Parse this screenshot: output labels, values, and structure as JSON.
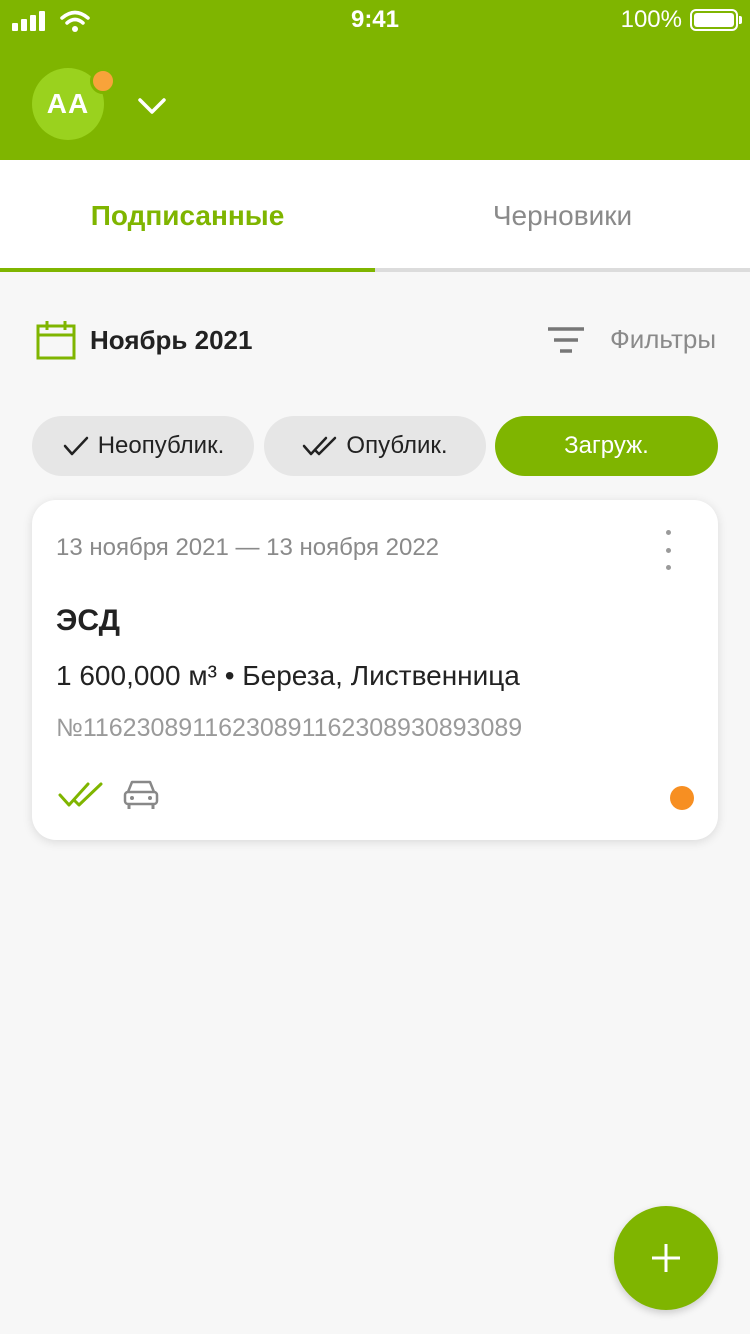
{
  "statusbar": {
    "time": "9:41",
    "battery": "100%"
  },
  "account": {
    "initials": "AA"
  },
  "tabs": [
    {
      "label": "Подписанные",
      "active": true
    },
    {
      "label": "Черновики",
      "active": false
    }
  ],
  "period": {
    "label": "Ноябрь 2021"
  },
  "filters": {
    "label": "Фильтры"
  },
  "chips": [
    {
      "label": "Неопублик.",
      "icon": "check-icon",
      "active": false
    },
    {
      "label": "Опублик.",
      "icon": "double-check-icon",
      "active": false
    },
    {
      "label": "Загруж.",
      "icon": "",
      "active": true
    }
  ],
  "cards": [
    {
      "date_range": "13 ноября 2021 — 13 ноября 2022",
      "title": "ЭСД",
      "volume": "1 600,000 м³ • Береза, Лиственница",
      "number": "№11623089116230891162308930893089",
      "icons": [
        "double-check-icon",
        "car-icon"
      ]
    }
  ],
  "colors": {
    "brand": "#7fb500",
    "accent_dot": "#f78f22",
    "muted": "#8a8a8a"
  }
}
